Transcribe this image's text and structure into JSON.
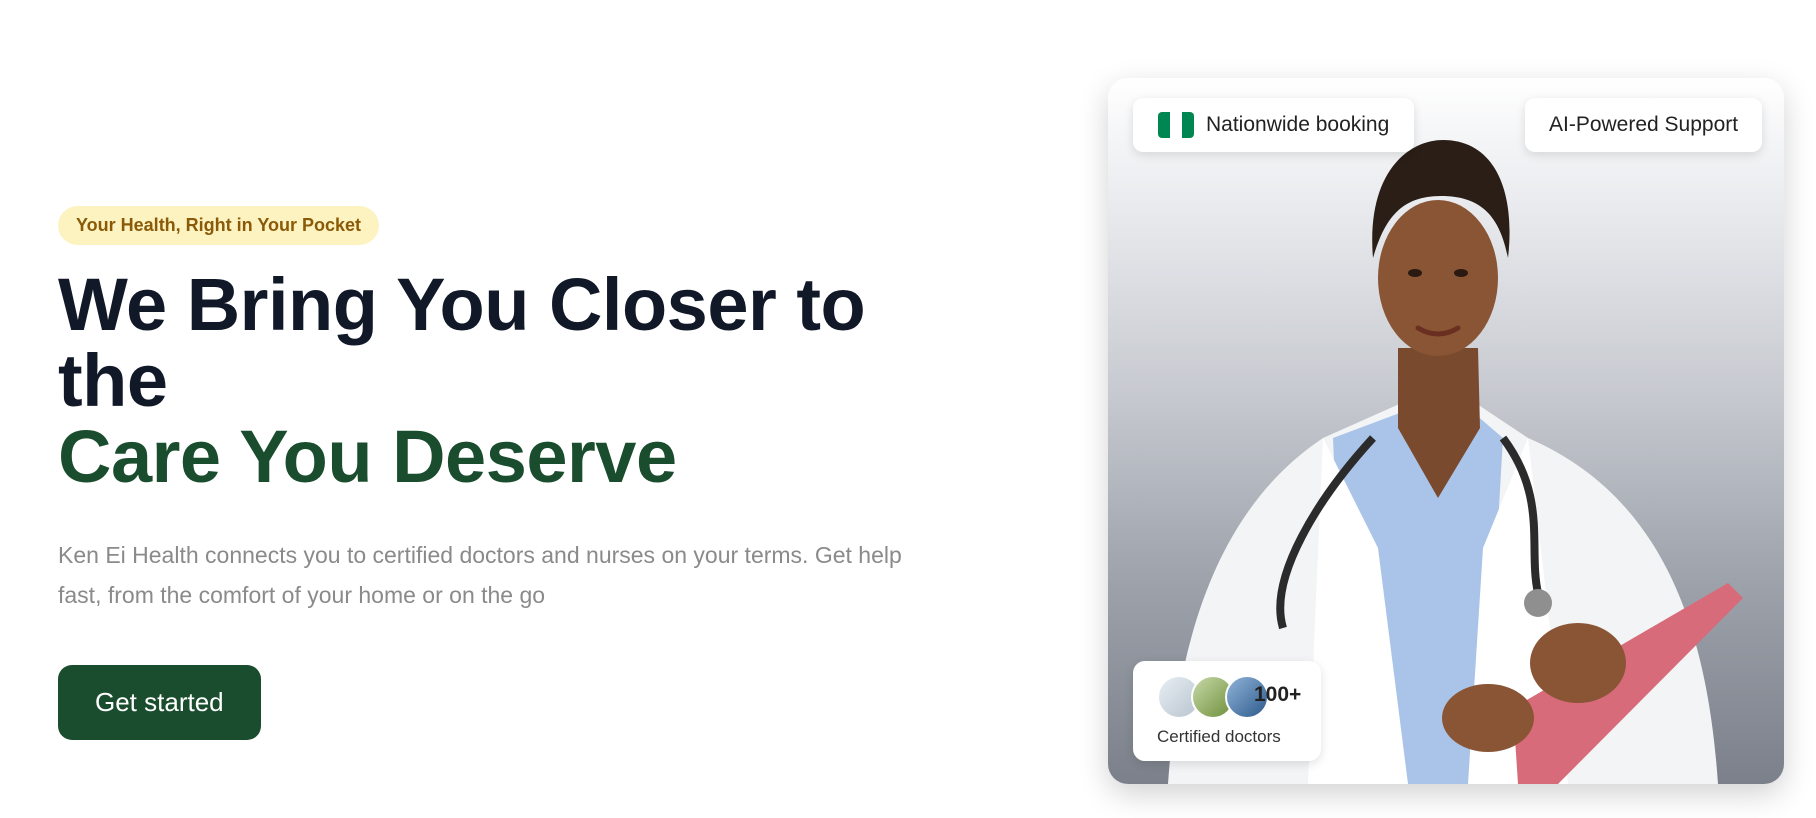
{
  "hero": {
    "tagline": "Your Health, Right in Your Pocket",
    "title_line1": "We Bring You Closer to the",
    "title_line2": "Care You Deserve",
    "description": "Ken Ei Health connects you to certified doctors and nurses on your terms. Get help fast, from the comfort of your home or on the go",
    "cta_label": "Get started"
  },
  "card": {
    "booking_label": "Nationwide booking",
    "ai_label": "AI-Powered Support",
    "doctors_count": "100+",
    "doctors_label": "Certified doctors",
    "flag_icon": "nigeria-flag-icon"
  },
  "colors": {
    "brand_green": "#1a4d2e",
    "tagline_bg": "#fdf3c0",
    "tagline_text": "#8a5a08",
    "title_dark": "#111827",
    "flag_green": "#008751"
  }
}
